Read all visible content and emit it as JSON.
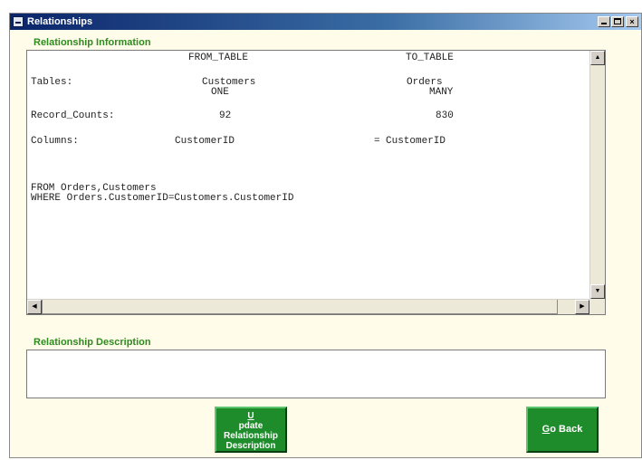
{
  "window": {
    "title": "Relationships"
  },
  "sections": {
    "info_label": "Relationship Information",
    "desc_label": "Relationship Description"
  },
  "info": {
    "headers": {
      "from": "FROM_TABLE",
      "to": "TO_TABLE"
    },
    "tables": {
      "label": "Tables:",
      "from": "Customers",
      "from_card": "ONE",
      "to": "Orders",
      "to_card": "MANY"
    },
    "counts": {
      "label": "Record_Counts:",
      "from": "92",
      "to": "830"
    },
    "columns": {
      "label": "Columns:",
      "from": "CustomerID",
      "eq": "=",
      "to": "CustomerID"
    },
    "sql": {
      "line1": "FROM Orders,Customers",
      "line2": "WHERE Orders.CustomerID=Customers.CustomerID"
    }
  },
  "description": {
    "value": ""
  },
  "buttons": {
    "update": {
      "accel": "U",
      "line1_rest": "pdate",
      "line2": "Relationship",
      "line3": "Description"
    },
    "goback": {
      "accel": "G",
      "rest": "o Back"
    }
  },
  "icons": {
    "app": "app-icon",
    "minimize": "minimize-icon",
    "maximize": "maximize-icon",
    "close": "close-icon",
    "scroll_up": "arrow-up-icon",
    "scroll_down": "arrow-down-icon",
    "scroll_left": "arrow-left-icon",
    "scroll_right": "arrow-right-icon"
  },
  "colors": {
    "accent_green": "#2e8b1f",
    "button_green": "#1f8c2b",
    "window_bg": "#fffde9",
    "titlebar": "#0a246a"
  }
}
